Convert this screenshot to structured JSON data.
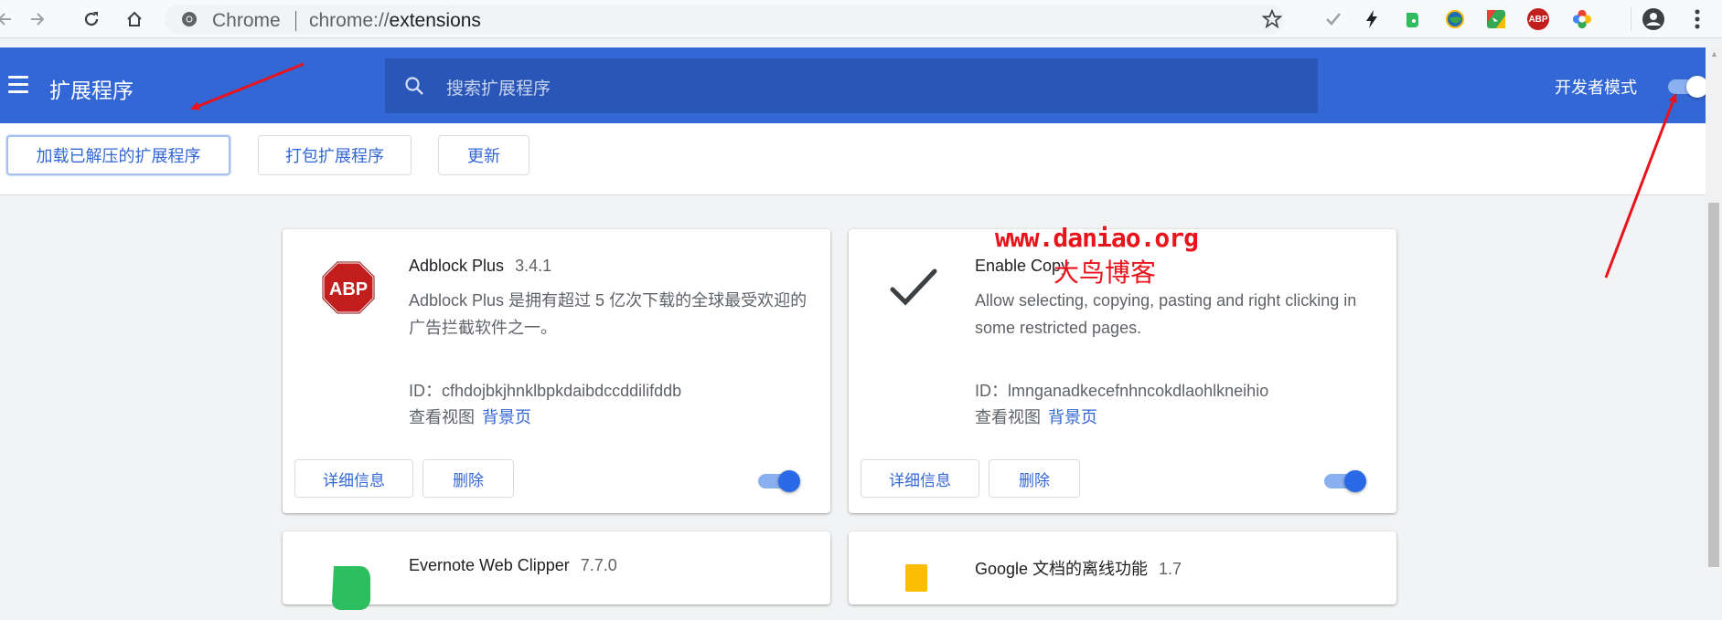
{
  "browser": {
    "site_label": "Chrome",
    "url_scheme": "chrome://",
    "url_path": "extensions",
    "back_icon": "arrow-left",
    "forward_icon": "arrow-right",
    "reload_icon": "reload",
    "home_icon": "home",
    "bookmark_icon": "star",
    "extension_icons": [
      "checkmark",
      "lightning",
      "evernote",
      "globe",
      "google-docs",
      "adblock-plus",
      "multicolor-flower"
    ],
    "profile_icon": "account-circle"
  },
  "header": {
    "title": "扩展程序",
    "search_placeholder": "搜索扩展程序",
    "devmode_label": "开发者模式",
    "devmode_on": true,
    "color": "#3367d6"
  },
  "toolbar": {
    "load_unpacked": "加载已解压的扩展程序",
    "pack": "打包扩展程序",
    "update": "更新"
  },
  "extensions": [
    {
      "name": "Adblock Plus",
      "version": "3.4.1",
      "description": "Adblock Plus 是拥有超过 5 亿次下载的全球最受欢迎的广告拦截软件之一。",
      "id_label": "ID：",
      "id": "cfhdojbkjhnklbpkdaibdccddilifddb",
      "views_label": "查看视图",
      "views_link": "背景页",
      "details_button": "详细信息",
      "remove_button": "删除",
      "enabled": true,
      "icon": "adblock-plus-stop-sign",
      "icon_text": "ABP"
    },
    {
      "name": "Enable Copy",
      "version": "",
      "description": "Allow selecting, copying, pasting and right clicking in some restricted pages.",
      "id_label": "ID：",
      "id": "lmnganadkecefnhncokdlaohlkneihio",
      "views_label": "查看视图",
      "views_link": "背景页",
      "details_button": "详细信息",
      "remove_button": "删除",
      "enabled": true,
      "icon": "checkmark"
    },
    {
      "name": "Evernote Web Clipper",
      "version": "7.7.0",
      "icon": "evernote-elephant"
    },
    {
      "name": "Google 文档的离线功能",
      "version": "1.7",
      "icon": "google-docs"
    }
  ],
  "watermark": {
    "line1": "www.daniao.org",
    "line2": "大鸟博客",
    "color": "#e8131b"
  }
}
